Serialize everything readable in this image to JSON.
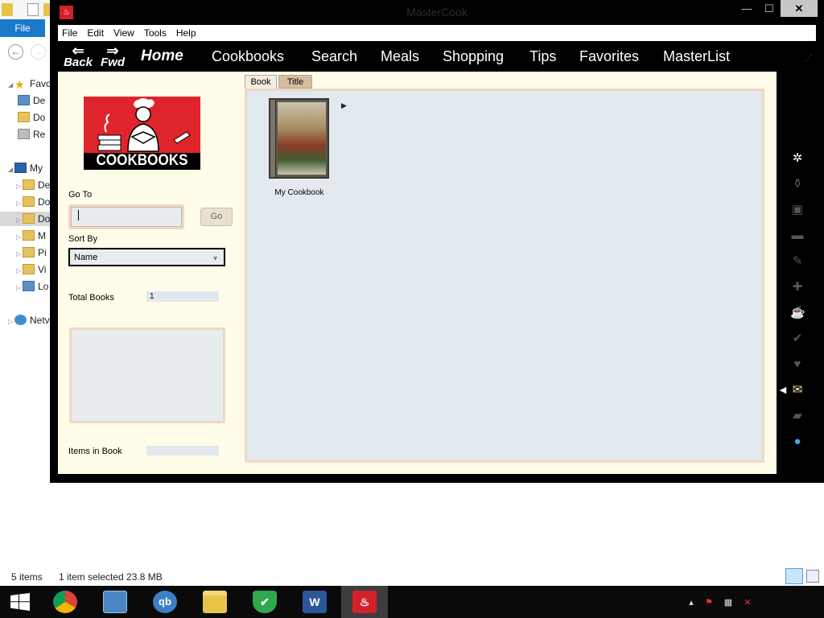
{
  "explorer": {
    "file_tab": "File",
    "nav_tree": [
      {
        "label": "Favo",
        "icon": "star-icon"
      },
      {
        "label": "De",
        "icon": "desktop-icon"
      },
      {
        "label": "Do",
        "icon": "downloads-icon"
      },
      {
        "label": "Re",
        "icon": "recent-places-icon"
      },
      {
        "label": "My",
        "icon": "computer-icon"
      },
      {
        "label": "De",
        "icon": "folder-icon"
      },
      {
        "label": "Do",
        "icon": "folder-icon"
      },
      {
        "label": "Do",
        "icon": "folder-icon"
      },
      {
        "label": "M",
        "icon": "folder-icon"
      },
      {
        "label": "Pi",
        "icon": "folder-icon"
      },
      {
        "label": "Vi",
        "icon": "folder-icon"
      },
      {
        "label": "Lo",
        "icon": "drive-icon"
      },
      {
        "label": "Netv",
        "icon": "network-icon"
      }
    ],
    "status": {
      "item_count": "5 items",
      "selection": "1 item selected  23.8 MB"
    }
  },
  "app": {
    "title": "MasterCook",
    "menu": [
      "File",
      "Edit",
      "View",
      "Tools",
      "Help"
    ],
    "nav": {
      "back": "Back",
      "fwd": "Fwd",
      "links": [
        "Home",
        "Cookbooks",
        "Search",
        "Meals",
        "Shopping",
        "Tips",
        "Favorites",
        "MasterList"
      ]
    },
    "left_panel": {
      "logo_text": "COOKBOOKS",
      "goto_label": "Go To",
      "goto_value": "",
      "go_button": "Go",
      "sort_label": "Sort By",
      "sort_value": "Name",
      "total_books_label": "Total Books",
      "total_books_value": "1",
      "items_in_book_label": "Items in Book",
      "items_in_book_value": ""
    },
    "tabs": [
      "Book",
      "Title"
    ],
    "active_tab": "Book",
    "books": [
      {
        "title": "My Cookbook"
      }
    ],
    "toolbar_icons": [
      "new-recipe-icon",
      "bottle-icon",
      "gift-icon",
      "card-icon",
      "pencil-icon",
      "plus-icon",
      "cup-icon",
      "spellcheck-icon",
      "heart-icon",
      "envelope-icon",
      "print-icon",
      "globe-icon"
    ]
  },
  "taskbar": {
    "apps": [
      "chrome-icon",
      "control-panel-icon",
      "quickbooks-icon",
      "file-explorer-icon",
      "security-shield-icon",
      "word-icon",
      "mastercook-icon"
    ],
    "quickbooks_glyph": "qb",
    "word_glyph": "W"
  }
}
